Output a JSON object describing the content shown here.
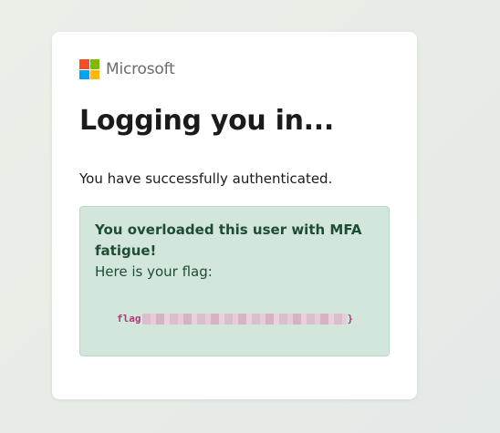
{
  "brand": {
    "name": "Microsoft",
    "logo_colors": [
      "#f25022",
      "#7fba00",
      "#00a4ef",
      "#ffb900"
    ]
  },
  "page": {
    "title": "Logging you in...",
    "subtitle": "You have successfully authenticated."
  },
  "alert": {
    "heading": "You overloaded this user with MFA fatigue!",
    "intro": "Here is your flag:",
    "flag_prefix": "flag",
    "flag_suffix": "}"
  },
  "colors": {
    "alert_background": "#d3e6dc",
    "alert_text": "#1e4d33",
    "flag_text": "#b5367a"
  }
}
